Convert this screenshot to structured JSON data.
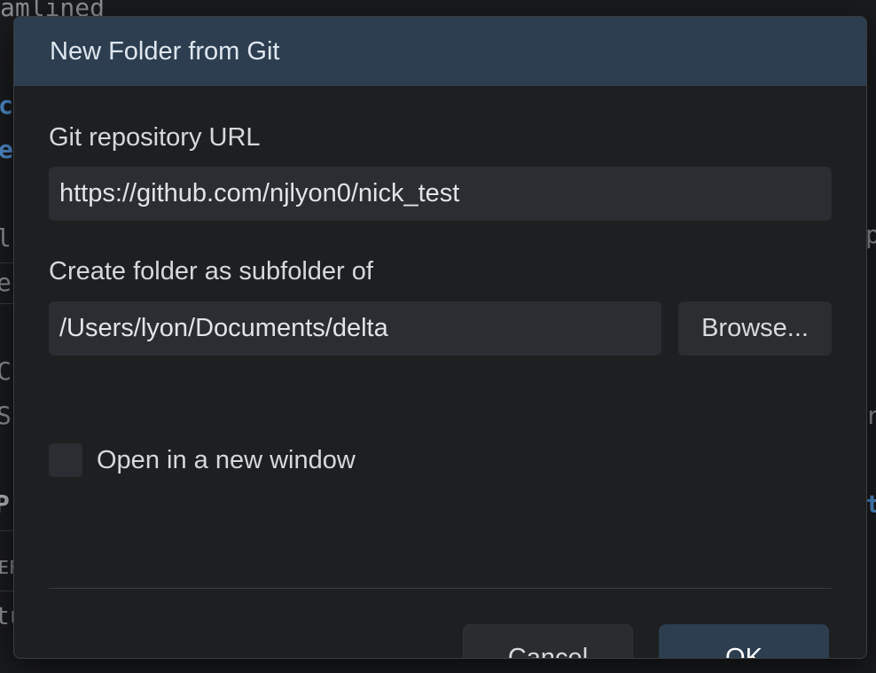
{
  "background": {
    "fragments": [
      "amlined",
      "c",
      "e",
      "l",
      "e",
      "C",
      "S",
      "P",
      "EF",
      "tu",
      "p",
      "r",
      "t"
    ]
  },
  "dialog": {
    "title": "New Folder from Git",
    "repo_url_label": "Git repository URL",
    "repo_url_value": "https://github.com/njlyon0/nick_test",
    "parent_label": "Create folder as subfolder of",
    "parent_value": "/Users/lyon/Documents/delta",
    "browse_label": "Browse...",
    "new_window_label": "Open in a new window",
    "new_window_checked": false,
    "cancel_label": "Cancel",
    "ok_label": "OK"
  },
  "colors": {
    "header_bg": "#2c3e50",
    "ok_bg": "#2c3e50",
    "dialog_bg": "#1e1f21",
    "input_bg": "#2a2d31"
  }
}
